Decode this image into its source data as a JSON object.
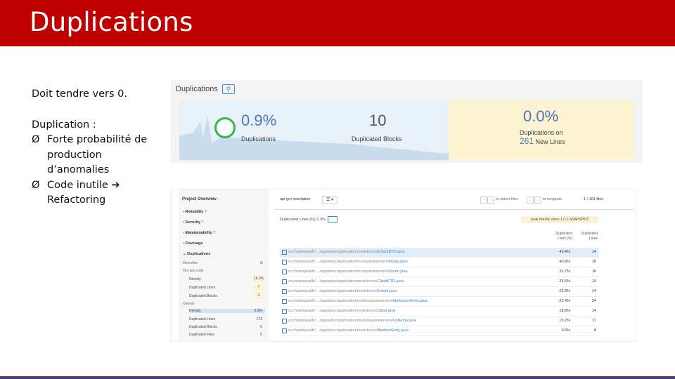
{
  "slide": {
    "title": "Duplications",
    "lines": {
      "line1": "Doit tendre vers 0.",
      "line2": "Duplication :",
      "bullet1": "Forte probabilité de production d’anomalies",
      "bullet2": "Code inutile",
      "bullet2_cont": "Refactoring"
    },
    "bullet_glyph": "Ø",
    "arrow_glyph": "➔"
  },
  "summary": {
    "header": "Duplications",
    "duplications_value": "0.9%",
    "duplications_label": "Duplications",
    "blocks_value": "10",
    "blocks_label": "Duplicated Blocks",
    "new_value": "0.0%",
    "new_label": "Duplications on",
    "new_lines_value": "261",
    "new_lines_label": "New Lines",
    "colors": {
      "ring": "#2eb84b",
      "accent": "#4a76b8",
      "new_code_bg": "#fbf3d2",
      "panel_bg": "#e8f1f8"
    }
  },
  "drilldown": {
    "nav": {
      "project_overview": "Project Overview",
      "items": [
        "Reliability",
        "Security",
        "Maintainability",
        "Coverage",
        "Duplications"
      ],
      "overview": "Overview",
      "on_new_code": "On new code",
      "new_metrics": [
        {
          "label": "Density",
          "value": "16.3%"
        },
        {
          "label": "Duplicated Lines",
          "value": "7"
        },
        {
          "label": "Duplicated Blocks",
          "value": "1"
        }
      ],
      "overall": "Overall",
      "overall_metrics": [
        {
          "label": "Density",
          "value": "2.3%"
        },
        {
          "label": "Duplicated Lines",
          "value": "173"
        },
        {
          "label": "Duplicated Blocks",
          "value": "5"
        },
        {
          "label": "Duplicated Files",
          "value": "5"
        }
      ]
    },
    "toolbar": {
      "project": "api-gm-inscription",
      "select_label": "list",
      "to_select": "to select files",
      "to_navigate": "to navigate",
      "count": "1 / 101 files"
    },
    "filter_label": "Duplicated Lines (%) 2.3%",
    "leak_label": "Leak Period: since 1.0.1-SNAPSHOT",
    "col1": "Duplicated Lines (%)",
    "col2": "Duplicated Lines",
    "rows": [
      {
        "path": "src/main/java/fr/…/app/adoc/application/model/core/",
        "file": "EnfantDTO.java",
        "pct": "43.4%",
        "lines": "14"
      },
      {
        "path": "src/main/java/fr/…/app/adoc/application/rest/questionnaire/",
        "file": "Route.java",
        "pct": "40.6%",
        "lines": "16"
      },
      {
        "path": "src/main/java/fr/…/app/adoc/application/rest/questionnaire/",
        "file": "Route.java",
        "pct": "32.7%",
        "lines": "16"
      },
      {
        "path": "src/main/java/fr/…/app/adoc/application/model/core/",
        "file": "ClientDTO.java",
        "pct": "25.6%",
        "lines": "14"
      },
      {
        "path": "src/main/java/fr/…/app/adoc/application/model/core/",
        "file": "Enfant.java",
        "pct": "23.3%",
        "lines": "14"
      },
      {
        "path": "src/main/java/fr/…/app/adoc/application/model/questionnaire/",
        "file": "IdeAssureEntry.java",
        "pct": "22.4%",
        "lines": "24"
      },
      {
        "path": "src/main/java/fr/…/app/adoc/application/model/core/",
        "file": "Client.java",
        "pct": "18.8%",
        "lines": "14"
      },
      {
        "path": "src/main/java/fr/…/app/adoc/application/model/questionnaire/",
        "file": "ListEntry.java",
        "pct": "15.2%",
        "lines": "17"
      },
      {
        "path": "src/main/java/fr/…/app/adoc/application/model/core/",
        "file": "AbstractEntry.java",
        "pct": "0.6%",
        "lines": "8"
      }
    ]
  }
}
